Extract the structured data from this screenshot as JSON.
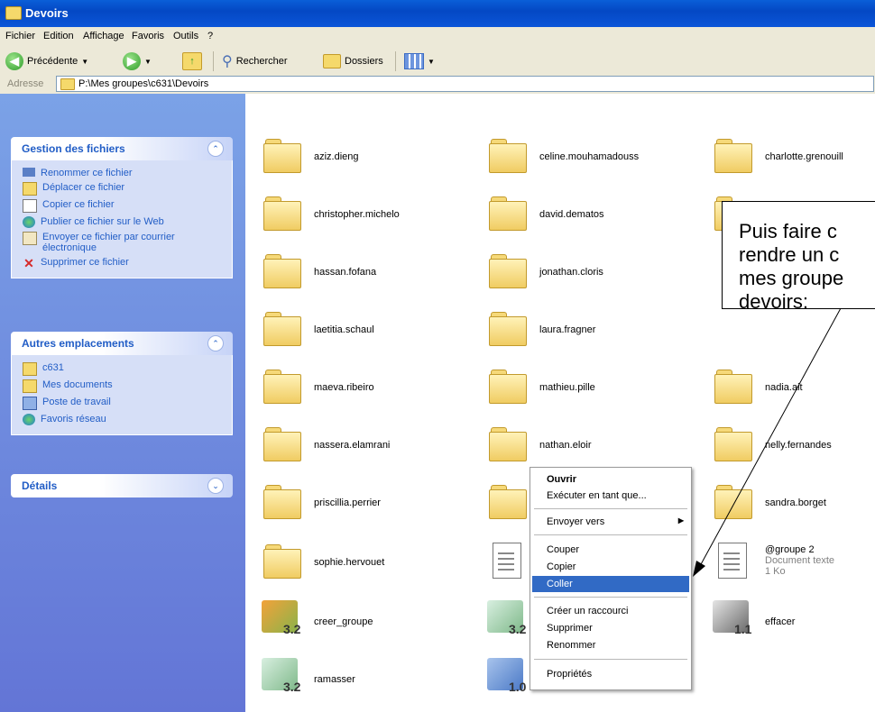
{
  "window": {
    "title": "Devoirs"
  },
  "menu": [
    "Fichier",
    "Edition",
    "Affichage",
    "Favoris",
    "Outils",
    "?"
  ],
  "toolbar": {
    "back": "Précédente",
    "search": "Rechercher",
    "folders": "Dossiers"
  },
  "address": {
    "label": "Adresse",
    "path": "P:\\Mes groupes\\c631\\Devoirs"
  },
  "sidebar": {
    "files_title": "Gestion des fichiers",
    "files_items": [
      "Renommer ce fichier",
      "Déplacer ce fichier",
      "Copier ce fichier",
      "Publier ce fichier sur le Web",
      "Envoyer ce fichier par courrier électronique",
      "Supprimer ce fichier"
    ],
    "places_title": "Autres emplacements",
    "places_items": [
      "c631",
      "Mes documents",
      "Poste de travail",
      "Favoris réseau"
    ],
    "details_title": "Détails"
  },
  "items": [
    "aziz.dieng",
    "celine.mouhamadouss",
    "charlotte.grenouill",
    "christopher.michelo",
    "david.dematos",
    "hassan.fofana",
    "jonathan.cloris",
    "laetitia.schaul",
    "laura.fragner",
    "maeva.ribeiro",
    "mathieu.pille",
    "nadia.ait",
    "nassera.elamrani",
    "nathan.eloir",
    "nelly.fernandes",
    "priscillia.perrier",
    "sandra.borget",
    "sophie.hervouet",
    "@groupe 2",
    "creer_groupe",
    "effacer",
    "ramasser"
  ],
  "groupe2": {
    "type": "Document texte",
    "size": "1 Ko"
  },
  "app_versions": {
    "creer_groupe": "3.2",
    "copy_icon": "3.2",
    "effacer": "1.1",
    "ramasser": "3.2",
    "net_icon": "1.0"
  },
  "context_menu": {
    "open": "Ouvrir",
    "run_as": "Exécuter en tant que...",
    "send_to": "Envoyer vers",
    "cut": "Couper",
    "copy": "Copier",
    "paste": "Coller",
    "shortcut": "Créer un raccourci",
    "delete": "Supprimer",
    "rename": "Renommer",
    "properties": "Propriétés"
  },
  "callout": "Puis faire c\nrendre un c\nmes groupe\ndevoirs:"
}
